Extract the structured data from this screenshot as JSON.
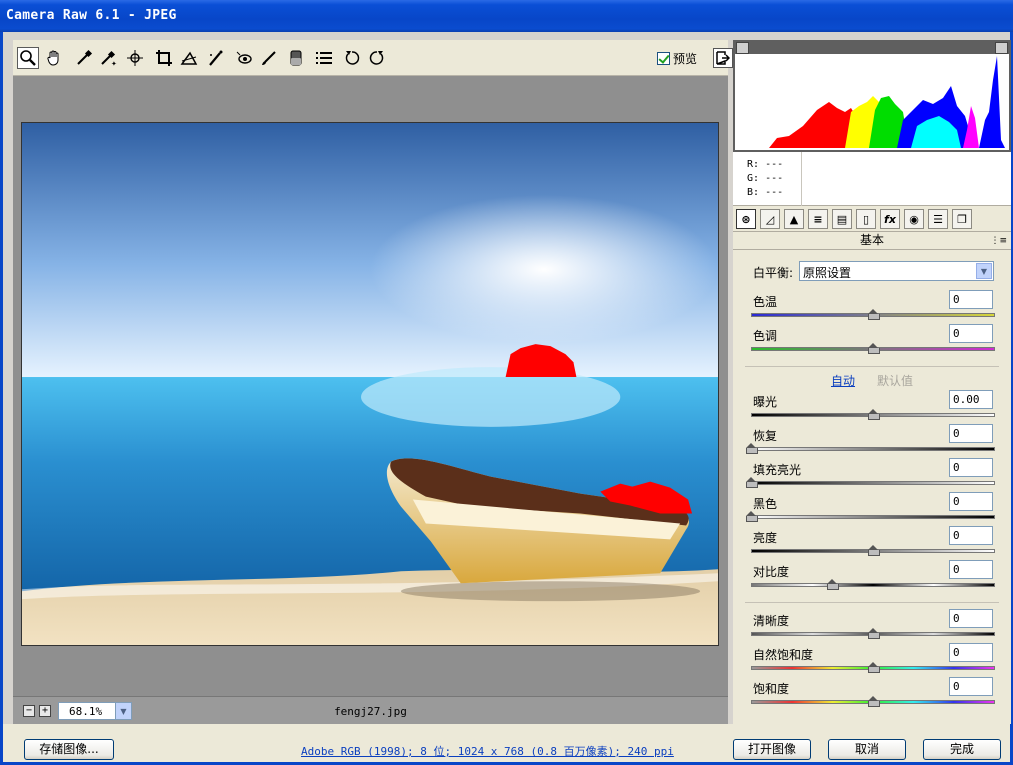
{
  "window": {
    "title": "Camera Raw 6.1 -  JPEG"
  },
  "toolbar": {
    "tools": [
      "zoom-icon",
      "hand-icon",
      "white-balance-icon",
      "color-sampler-icon",
      "target-adjust-icon",
      "crop-icon",
      "straighten-icon",
      "spot-removal-icon",
      "red-eye-icon",
      "adjustment-brush-icon",
      "graduated-filter-icon",
      "preferences-icon",
      "rotate-left-icon",
      "rotate-right-icon"
    ],
    "preview_label": "预览",
    "preview_checked": true
  },
  "status": {
    "zoom_value": "68.1%",
    "filename": "fengj27.jpg"
  },
  "histogram": {
    "r_label": "R:",
    "g_label": "G:",
    "b_label": "B:",
    "r_value": "---",
    "g_value": "---",
    "b_value": "---"
  },
  "panel": {
    "tabs": [
      "basic-icon",
      "tone-curve-icon",
      "detail-icon",
      "hsl-icon",
      "split-toning-icon",
      "lens-icon",
      "effects-icon",
      "camera-calibration-icon",
      "presets-icon",
      "snapshots-icon"
    ],
    "section_title": "基本",
    "white_balance_label": "白平衡:",
    "white_balance_value": "原照设置",
    "auto_label": "自动",
    "default_label": "默认值",
    "sliders": [
      {
        "label": "色温",
        "value": "0",
        "position": 0.5
      },
      {
        "label": "色调",
        "value": "0",
        "position": 0.5
      },
      {
        "label": "曝光",
        "value": "0.00",
        "position": 0.5
      },
      {
        "label": "恢复",
        "value": "0",
        "position": 0.0
      },
      {
        "label": "填充亮光",
        "value": "0",
        "position": 0.0
      },
      {
        "label": "黑色",
        "value": "0",
        "position": 0.0
      },
      {
        "label": "亮度",
        "value": "0",
        "position": 0.5
      },
      {
        "label": "对比度",
        "value": "0",
        "position": 0.33
      },
      {
        "label": "清晰度",
        "value": "0",
        "position": 0.5
      },
      {
        "label": "自然饱和度",
        "value": "0",
        "position": 0.5
      },
      {
        "label": "饱和度",
        "value": "0",
        "position": 0.5
      }
    ]
  },
  "footer": {
    "save_label": "存储图像...",
    "info_text": "Adobe RGB (1998); 8 位; 1024 x 768 (0.8 百万像素); 240 ppi",
    "open_label": "打开图像",
    "cancel_label": "取消",
    "done_label": "完成"
  }
}
